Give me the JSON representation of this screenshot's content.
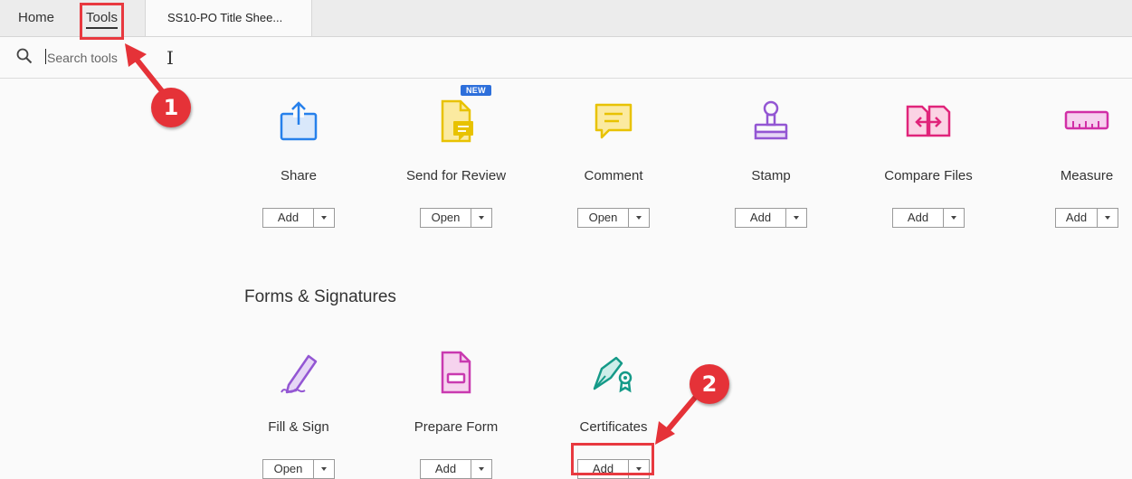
{
  "tabs": {
    "home": "Home",
    "tools": "Tools",
    "document": "SS10-PO Title Shee..."
  },
  "search": {
    "placeholder": "Search tools"
  },
  "tools": [
    {
      "label": "Share",
      "button": "Add",
      "icon": "share-icon",
      "color": "#2680eb"
    },
    {
      "label": "Send for Review",
      "button": "Open",
      "icon": "send-for-review-icon",
      "color": "#e8c200",
      "badge": "NEW"
    },
    {
      "label": "Comment",
      "button": "Open",
      "icon": "comment-icon",
      "color": "#e8c200"
    },
    {
      "label": "Stamp",
      "button": "Add",
      "icon": "stamp-icon",
      "color": "#9356d3"
    },
    {
      "label": "Compare Files",
      "button": "Add",
      "icon": "compare-files-icon",
      "color": "#e0247a"
    },
    {
      "label": "Measure",
      "button": "Add",
      "icon": "measure-icon",
      "color": "#d12fa6"
    }
  ],
  "forms_section": {
    "title": "Forms & Signatures",
    "tools": [
      {
        "label": "Fill & Sign",
        "button": "Open",
        "icon": "fill-sign-icon",
        "color": "#9356d3"
      },
      {
        "label": "Prepare Form",
        "button": "Add",
        "icon": "prepare-form-icon",
        "color": "#c93ab0"
      },
      {
        "label": "Certificates",
        "button": "Add",
        "icon": "certificates-icon",
        "color": "#159a88"
      }
    ]
  },
  "callouts": {
    "one": "1",
    "two": "2"
  },
  "annotation_color": "#e53238"
}
